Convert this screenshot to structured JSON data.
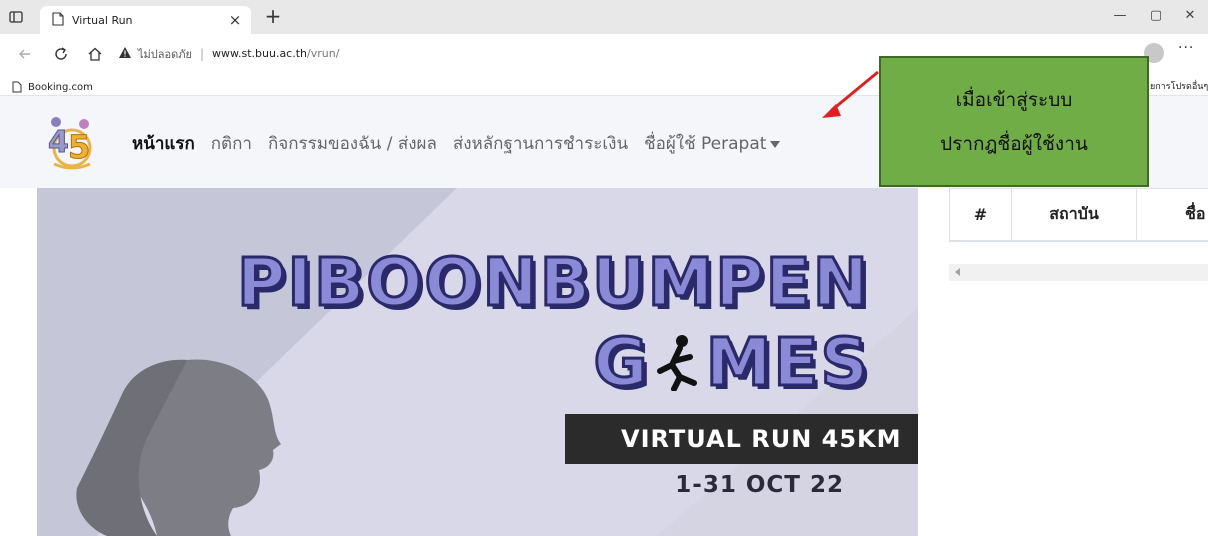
{
  "browser": {
    "tab_title": "Virtual Run",
    "tab_close": "×",
    "new_tab": "+",
    "minimize": "—",
    "restore": "▢",
    "close": "✕",
    "security_warning": "ไม่ปลอดภัย",
    "url_separator": "|",
    "url_host": "www.st.buu.ac.th",
    "url_path": "/vrun/",
    "more": "···",
    "favorite_item": "Booking.com",
    "other_favorites": "ยการโปรดอื่นๆ"
  },
  "site": {
    "menu": [
      {
        "label": "หน้าแรก"
      },
      {
        "label": "กติกา"
      },
      {
        "label": "กิจกรรมของฉัน / ส่งผล"
      },
      {
        "label": "ส่งหลักฐานการชำระเงิน"
      },
      {
        "label": "ชื่อผู้ใช้ Perapat"
      }
    ]
  },
  "annotation": {
    "line1": "เมื่อเข้าสู่ระบบ",
    "line2": "ปรากฎชื่อผู้ใช้งาน",
    "arrow_color": "#e02020",
    "box_color": "#70ad47"
  },
  "banner": {
    "title_line1": "PIBOONBUMPEN",
    "title_line2_a": "G",
    "title_line2_b": "MES",
    "subtitle": "VIRTUAL RUN 45KM",
    "dates": "1-31 OCT 22"
  },
  "table": {
    "headers": [
      "#",
      "สถาบัน",
      "ชื่อ"
    ]
  },
  "logo_text": "45"
}
